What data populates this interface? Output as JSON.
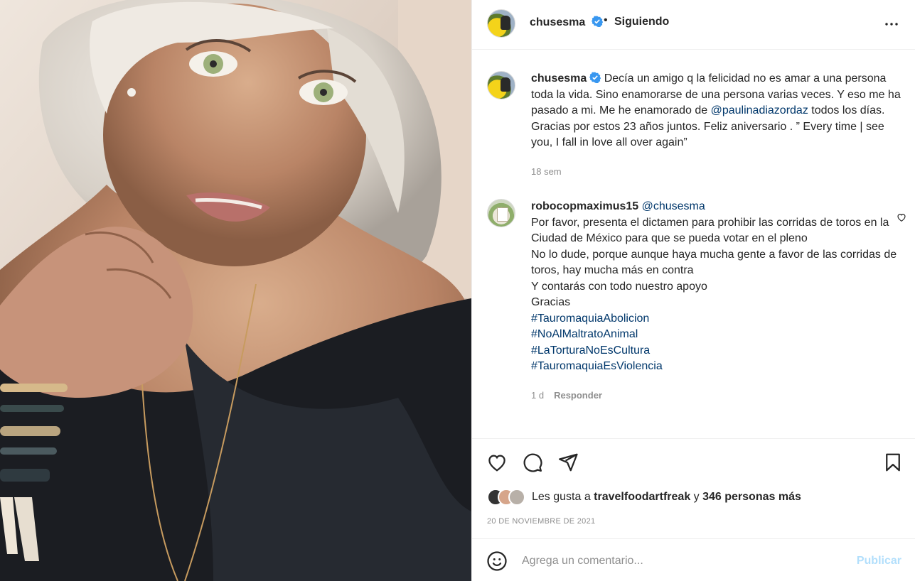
{
  "post": {
    "username": "chusesma",
    "follow_separator": "•",
    "follow_status": "Siguiendo"
  },
  "caption": {
    "username": "chusesma",
    "text_before": "Decía un amigo q la felicidad no es amar a una persona toda la vida. Sino enamorarse de una persona varias veces. Y eso me ha pasado a mi. Me he enamorado de ",
    "mention": "@paulinadiazordaz",
    "text_after": " todos los días. Gracias por estos 23 años juntos. Feliz aniversario . ” Every time | see you, I fall in love all over again”",
    "time": "18 sem"
  },
  "comment": {
    "username": "robocopmaximus15",
    "mention": "@chusesma",
    "line1": "Por favor, presenta el dictamen para prohibir las corridas de toros en la Ciudad de México para que se pueda votar en el pleno",
    "line2": "No lo dude, porque aunque haya mucha gente a favor de las corridas de toros, hay mucha más en contra",
    "line3": "Y contarás con todo nuestro apoyo",
    "line4": "Gracias",
    "hashtags": [
      "#TauromaquiaAbolicion",
      "#NoAlMaltratoAnimal",
      "#LaTorturaNoEsCultura",
      "#TauromaquiaEsViolencia"
    ],
    "time": "1 d",
    "reply_label": "Responder"
  },
  "likes": {
    "prefix": "Les gusta a ",
    "user": "travelfoodartfreak",
    "middle": " y ",
    "count_text": "346 personas más"
  },
  "date": "20 DE NOVIEMBRE DE 2021",
  "composer": {
    "placeholder": "Agrega un comentario...",
    "publish_label": "Publicar"
  },
  "colors": {
    "verified": "#3897f0",
    "link": "#00376b",
    "muted": "#8e8e8e",
    "publish_disabled": "#b2dffc"
  },
  "icons": [
    "verified-badge-icon",
    "more-options-icon",
    "heart-icon",
    "comment-icon",
    "share-icon",
    "bookmark-icon",
    "emoji-icon",
    "small-heart-icon"
  ]
}
